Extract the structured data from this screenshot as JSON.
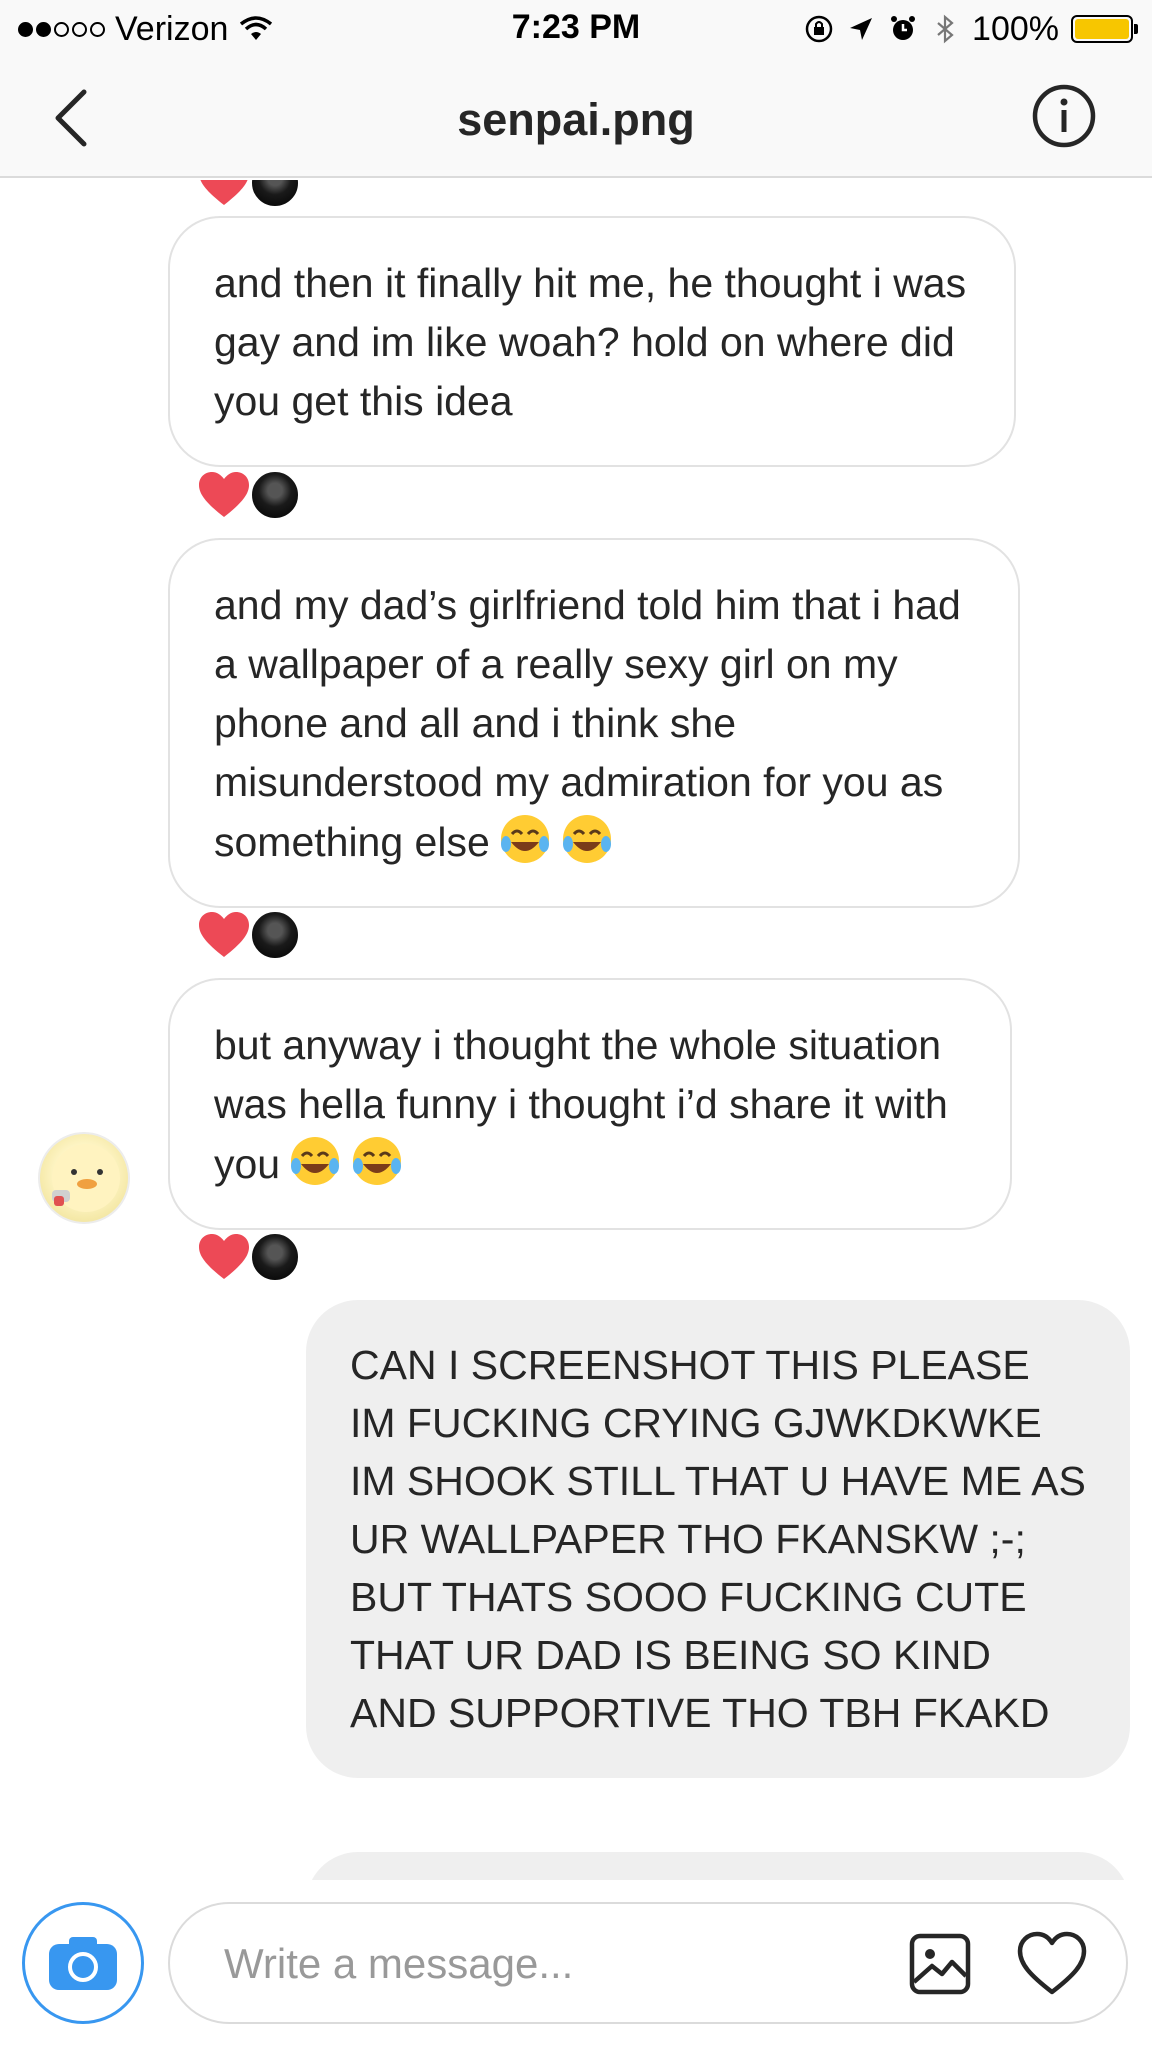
{
  "status_bar": {
    "carrier": "Verizon",
    "time": "7:23 PM",
    "battery_percent": "100%",
    "signal_strength": 2,
    "signal_max": 5
  },
  "header": {
    "title": "senpai.png"
  },
  "thread": {
    "messages": [
      {
        "from": "them",
        "text": "and then it finally hit me, he thought i was gay and im like woah? hold on where did you get this idea"
      },
      {
        "from": "them",
        "text": "and my dad’s girlfriend told him that i had a wallpaper of a really sexy girl on my phone and all and i think she misunderstood my admiration for you as something else",
        "emojis": "😂😂"
      },
      {
        "from": "them",
        "text": "but anyway i thought the whole situation was hella funny i thought i’d share it with you",
        "emojis": "😂😂"
      },
      {
        "from": "me",
        "text": "CAN I SCREENSHOT THIS PLEASE IM FUCKING CRYING GJWKDKWKE IM SHOOK STILL THAT U HAVE ME AS UR WALLPAPER THO FKANSKW ;-; BUT THATS SOOO FUCKING CUTE THAT UR DAD IS BEING SO KIND AND SUPPORTIVE THO TBH FKAKD"
      }
    ]
  },
  "composer": {
    "placeholder": "Write a message..."
  },
  "colors": {
    "accent_blue": "#3897f0",
    "heart_red": "#ed4956",
    "outgoing_bubble": "#efefef",
    "battery_yellow": "#f7c600"
  }
}
